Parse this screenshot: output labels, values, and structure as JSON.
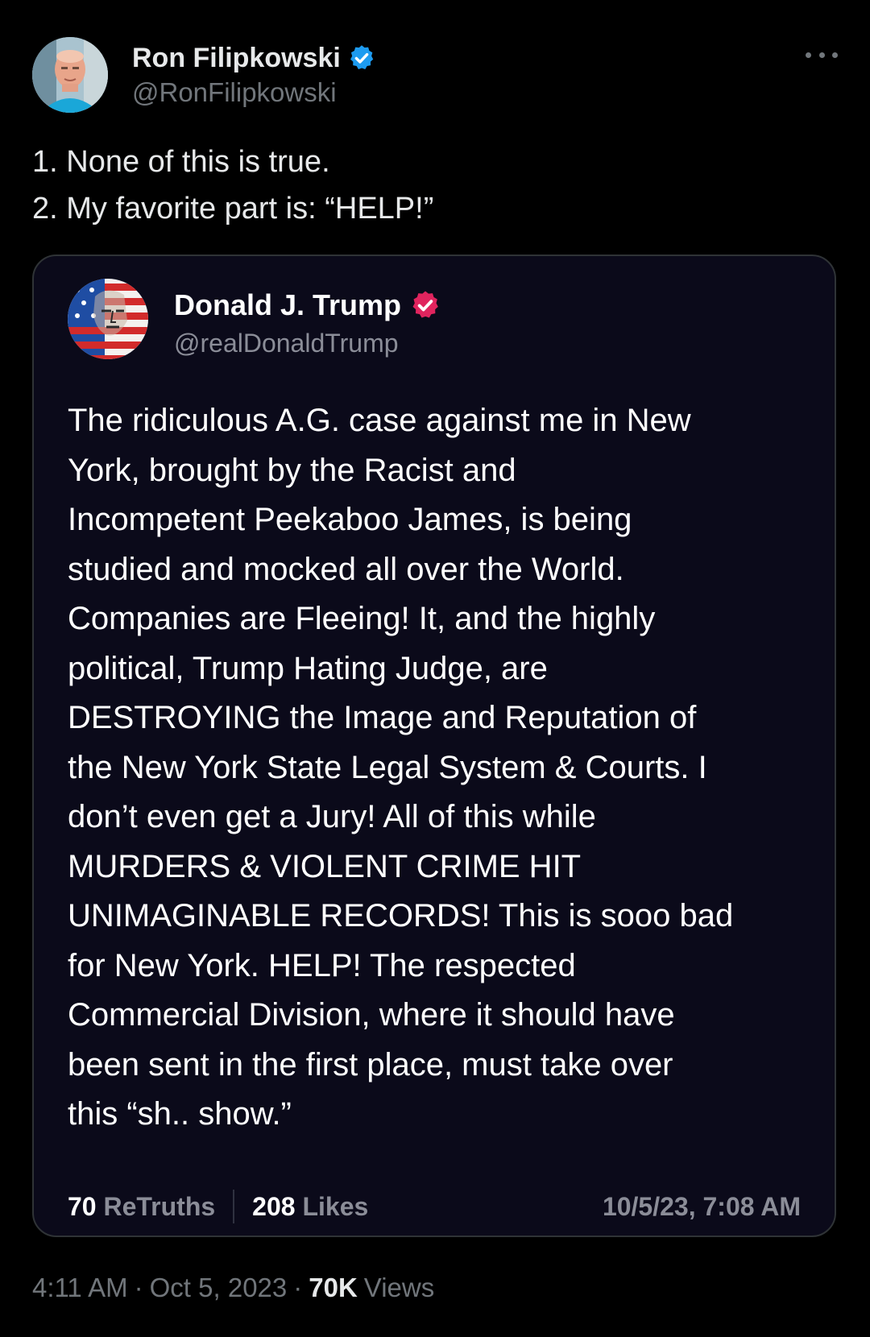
{
  "author": {
    "display_name": "Ron Filipkowski",
    "handle": "@RonFilipkowski",
    "verified_badge_color": "#1d9bf0",
    "avatar": "profile-photo-avatar"
  },
  "more_menu": {
    "icon": "more-horizontal-icon"
  },
  "tweet": {
    "lines": [
      "1. None of this is true.",
      "2. My favorite part is: “HELP!”"
    ]
  },
  "quoted_post": {
    "display_name": "Donald J. Trump",
    "handle": "@realDonaldTrump",
    "verified_badge_color": "#e0245e",
    "avatar": "flag-face-avatar",
    "text_lines": [
      "The ridiculous A.G. case against me in New",
      "York, brought by the Racist and",
      "Incompetent Peekaboo James, is being",
      "studied and mocked all over the World.",
      "Companies are Fleeing! It, and the highly",
      "political, Trump Hating Judge, are",
      "DESTROYING the Image and Reputation of",
      "the New York State Legal System & Courts. I",
      "don’t even get a Jury! All of this while",
      "MURDERS & VIOLENT CRIME HIT",
      "UNIMAGINABLE RECORDS! This is sooo bad",
      "for New York. HELP! The respected",
      "Commercial Division, where it should have",
      "been sent in the first place, must take over",
      "this “sh.. show.”"
    ],
    "retruths_count": "70",
    "retruths_label": "ReTruths",
    "likes_count": "208",
    "likes_label": "Likes",
    "date": "10/5/23, 7:08 AM"
  },
  "meta": {
    "time": "4:11 AM",
    "separator": "·",
    "date": "Oct 5, 2023",
    "views_count": "70K",
    "views_label": "Views"
  },
  "colors": {
    "background": "#000000",
    "card_background": "#0b0a1a",
    "border": "#2f3336",
    "secondary_text": "#71767b"
  }
}
